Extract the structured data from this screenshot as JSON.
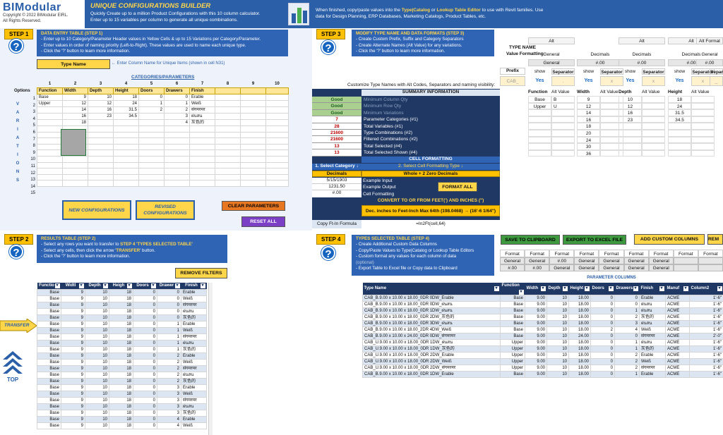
{
  "header": {
    "logo": "BIModular",
    "copyright": "Copyright © 2022 BIModular EIRL.",
    "rights": "All Rights Reserved.",
    "title": "UNIQUE CONFIGURATIONS BUILDER",
    "desc1": "Quickly Create up to a million Product Configurations with this 10 column calculator.",
    "desc2": "Enter up to 15 variables per column to generate all unique combinations.",
    "note_a": "When finished, copy/paste values into the ",
    "note_b": "Type|Catalog",
    "note_c": " or ",
    "note_d": "Lookup Table Editor",
    "note_e": " to use with Revit families.  Use data for Design Planning, ERP Databases, Marketing Catalogs, Product Tables, etc."
  },
  "step1": {
    "label": "STEP 1",
    "title": "DATA ENTRY TABLE  (STEP 1)",
    "lines": [
      "- Enter up to 10 Category/Parameter Header values in Yellow Cells & up to 15 Variations per Category/Parameter.",
      "- Enter values in order of naming priority (Left-to-Right).  These values are used to name each unique type.",
      "- Click the '?' button to learn more information."
    ],
    "type_name": "Type Name",
    "type_name_hint": "Enter Column Name for Unique Items (shown in cell N31)",
    "cat_title": "CATEGORIES/PARAMETERS",
    "col_nums": [
      "1",
      "2",
      "3",
      "4",
      "5",
      "6",
      "7",
      "8",
      "9",
      "10"
    ],
    "options_label": "Options",
    "headers": [
      "Function",
      "Width",
      "Depth",
      "Height",
      "Doors",
      "Drawers",
      "Finish",
      "",
      "",
      ""
    ],
    "rows": [
      [
        "Base",
        "9",
        "10",
        "18",
        "0",
        "0",
        "Érable",
        "",
        "",
        ""
      ],
      [
        "Upper",
        "12",
        "12",
        "24",
        "1",
        "1",
        "Weiß",
        "",
        "",
        ""
      ],
      [
        "",
        "14",
        "16",
        "31.5",
        "2",
        "2",
        "संगमरमर",
        "",
        "",
        ""
      ],
      [
        "",
        "16",
        "23",
        "34.5",
        "",
        "3",
        "ฝนสน",
        "",
        "",
        ""
      ],
      [
        "",
        "18",
        "",
        "",
        "",
        "4",
        "灰色的",
        "",
        "",
        ""
      ],
      [
        "",
        "",
        "",
        "",
        "",
        "",
        "",
        "",
        "",
        ""
      ],
      [
        "",
        "",
        "",
        "",
        "",
        "",
        "",
        "",
        "",
        ""
      ],
      [
        "",
        "",
        "",
        "",
        "",
        "",
        "",
        "",
        "",
        ""
      ],
      [
        "",
        "",
        "",
        "",
        "",
        "",
        "",
        "",
        "",
        ""
      ],
      [
        "",
        "",
        "",
        "",
        "",
        "",
        "",
        "",
        "",
        ""
      ],
      [
        "",
        "",
        "",
        "",
        "",
        "",
        "",
        "",
        "",
        ""
      ],
      [
        "",
        "",
        "",
        "",
        "",
        "",
        "",
        "",
        "",
        ""
      ],
      [
        "",
        "",
        "",
        "",
        "",
        "",
        "",
        "",
        "",
        ""
      ],
      [
        "",
        "",
        "",
        "",
        "",
        "",
        "",
        "",
        "",
        ""
      ],
      [
        "",
        "",
        "",
        "",
        "",
        "",
        "",
        "",
        "",
        ""
      ]
    ],
    "row_nums": [
      "1",
      "2",
      "3",
      "4",
      "5",
      "6",
      "7",
      "8",
      "9",
      "10",
      "11",
      "12",
      "13",
      "14",
      "15"
    ],
    "variations": [
      "V",
      "A",
      "R",
      "I",
      "A",
      "T",
      "I",
      "O",
      "N",
      "S"
    ],
    "new_config": "NEW CONFIGURATIONS",
    "revised_config": "REVISED CONFIGURATIONS",
    "clear": "CLEAR PARAMETERS",
    "reset": "RESET ALL"
  },
  "step2": {
    "label": "STEP 2",
    "title": "RESULTS TABLE (STEP 2)",
    "line1a": "- Select any rows you want to transfer to ",
    "line1b": "STEP 4 'TYPES SELECTED TABLE'",
    "line2a": "- Select any cells, then click the arrow '",
    "line2b": "TRANSFER",
    "line2c": "' button.",
    "line3": "- Click the '?' button to learn more information.",
    "remove_filters": "REMOVE FILTERS",
    "transfer": "TRANSFER",
    "top": "TOP",
    "headers": [
      "Functio",
      "Widtl",
      "Depth",
      "Heigh",
      "Doors",
      "Drawer",
      "Finish"
    ],
    "rows": [
      [
        "Base",
        "9",
        "10",
        "18",
        "0",
        "0",
        "Érable"
      ],
      [
        "Base",
        "9",
        "10",
        "18",
        "0",
        "0",
        "Weiß"
      ],
      [
        "Base",
        "9",
        "10",
        "18",
        "0",
        "0",
        "संगमरमर"
      ],
      [
        "Base",
        "9",
        "10",
        "18",
        "0",
        "0",
        "ฝนสน"
      ],
      [
        "Base",
        "9",
        "10",
        "18",
        "0",
        "0",
        "灰色的"
      ],
      [
        "Base",
        "9",
        "10",
        "18",
        "0",
        "1",
        "Érable"
      ],
      [
        "Base",
        "9",
        "10",
        "18",
        "0",
        "1",
        "Weiß"
      ],
      [
        "Base",
        "9",
        "10",
        "18",
        "0",
        "1",
        "संगमरमर"
      ],
      [
        "Base",
        "9",
        "10",
        "18",
        "0",
        "1",
        "ฝนสน"
      ],
      [
        "Base",
        "9",
        "10",
        "18",
        "0",
        "1",
        "灰色的"
      ],
      [
        "Base",
        "9",
        "10",
        "18",
        "0",
        "2",
        "Érable"
      ],
      [
        "Base",
        "9",
        "10",
        "18",
        "0",
        "2",
        "Weiß"
      ],
      [
        "Base",
        "9",
        "10",
        "18",
        "0",
        "2",
        "संगमरमर"
      ],
      [
        "Base",
        "9",
        "10",
        "18",
        "0",
        "2",
        "ฝนสน"
      ],
      [
        "Base",
        "9",
        "10",
        "18",
        "0",
        "2",
        "灰色的"
      ],
      [
        "Base",
        "9",
        "10",
        "18",
        "0",
        "3",
        "Érable"
      ],
      [
        "Base",
        "9",
        "10",
        "18",
        "0",
        "3",
        "Weiß"
      ],
      [
        "Base",
        "9",
        "10",
        "18",
        "0",
        "3",
        "संगमरमर"
      ],
      [
        "Base",
        "9",
        "10",
        "18",
        "0",
        "3",
        "ฝนสน"
      ],
      [
        "Base",
        "9",
        "10",
        "18",
        "0",
        "3",
        "灰色的"
      ],
      [
        "Base",
        "9",
        "10",
        "18",
        "0",
        "4",
        "Érable"
      ],
      [
        "Base",
        "9",
        "10",
        "18",
        "0",
        "4",
        "Weiß"
      ]
    ]
  },
  "step3": {
    "label": "STEP 3",
    "title": "MODIFY TYPE NAME AND DATA FORMATS (STEP 3)",
    "lines": [
      "- Create Custom Prefix, Suffix and Category Separators",
      "- Create Alternate Names (Alt Value) for any variations.",
      "- Click the '?' button to learn more information."
    ],
    "customize": "Customize Type Names with Alt Codes, Separators and naming visibility:",
    "summary_title": "SUMMARY INFORMATION",
    "summary": [
      [
        "Good",
        "Minimum Column Qty"
      ],
      [
        "Good",
        "Minimum Row Qty"
      ],
      [
        "Good",
        "Minimum Variations"
      ],
      [
        "7",
        "Parameter Categories (#1)"
      ],
      [
        "28",
        "Total Variables (#1)"
      ],
      [
        "21600",
        "Type Combinations (#2)"
      ],
      [
        "21600",
        "Filtered Combinations (#2)"
      ],
      [
        "13",
        "Total Selected (#4)"
      ],
      [
        "13",
        "Total Selected Shown (#4)"
      ]
    ],
    "cell_formatting": "CELL FORMATTING",
    "select_category": "1. Select Category",
    "select_type": "2. Select Cell Formatting Type",
    "decimals": "Decimals",
    "whole_zero": "Whole + 2 Zero Decimals",
    "ex_in_val": "5/15/1903",
    "ex_in_lbl": "Example Input",
    "ex_out_val": "1231.50",
    "ex_out_lbl": "Example Output",
    "cf_val": "#.00",
    "cf_lbl": "Cell Formatting",
    "format_all": "FORMAT ALL",
    "convert": "CONVERT TO OR FROM FEET(') AND INCHES (\")",
    "dec_inch": "Dec. inches to Feet-Inch Max 64th  (198.0468) → (16'-6  1/64\")",
    "copy_formula": "Copy Ft-In Formula",
    "formula": "=In2Ft(cell,64)",
    "type_name_label": "TYPE NAME",
    "value_formatting": "Value Formatting",
    "prefix": "Prefix",
    "prefix_val": "CAB_",
    "fmt_cols": [
      {
        "alt": "Alt",
        "fmt": "General",
        "fmt2": "General",
        "show": "show",
        "sep": "Separator",
        "yes": "Yes",
        "sepv": ".",
        "h1": "Function",
        "h2": "Alt Value",
        "vals": [
          [
            "Base",
            "B"
          ],
          [
            "Upper",
            "U"
          ],
          [
            "",
            ""
          ],
          [
            "",
            ""
          ],
          [
            "",
            ""
          ],
          [
            "",
            ""
          ],
          [
            "",
            ""
          ],
          [
            "",
            ""
          ]
        ]
      },
      {
        "alt": "",
        "fmt": "Decimals",
        "fmt2": "#.00",
        "show": "show",
        "sep": "Separator",
        "yes": "Yes",
        "sepv": "x",
        "h1": "Width",
        "h2": "Alt Value",
        "vals": [
          [
            "9",
            ""
          ],
          [
            "12",
            ""
          ],
          [
            "14",
            ""
          ],
          [
            "16",
            ""
          ],
          [
            "18",
            ""
          ],
          [
            "20",
            ""
          ],
          [
            "24",
            ""
          ],
          [
            "30",
            ""
          ],
          [
            "36",
            ""
          ]
        ]
      },
      {
        "alt": "Alt",
        "fmt": "Decimals",
        "fmt2": "#.00",
        "show": "show",
        "sep": "Separator",
        "yes": "Yes",
        "sepv": "x",
        "h1": "Depth",
        "h2": "Alt Value",
        "vals": [
          [
            "10",
            ""
          ],
          [
            "12",
            ""
          ],
          [
            "16",
            ""
          ],
          [
            "23",
            ""
          ]
        ]
      },
      {
        "alt": "Alt",
        "fmt": "Decimals",
        "fmt2": "#.00",
        "show": "show",
        "sep": "Separator",
        "yes": "Yes",
        "sepv": "x",
        "h1": "Height",
        "h2": "Alt Value",
        "vals": [
          [
            "18",
            ""
          ],
          [
            "24",
            ""
          ],
          [
            "31.5",
            ""
          ],
          [
            "34.5",
            ""
          ]
        ]
      },
      {
        "alt": "Alt Format",
        "fmt": "General",
        "fmt2": "#.00",
        "show": "",
        "sep": "Separator",
        "yes": "",
        "sepv": "_",
        "h1": "",
        "h2": "",
        "vals": []
      }
    ]
  },
  "step4": {
    "label": "STEP 4",
    "title": "TYPES SELECTED TABLE (STEP 4)",
    "lines": [
      "- Create Additional Custom Data Columns",
      "- Copy/Paste Values to Type|Catalog or Lookup Table Editors",
      "- Custom format any values for each column of data",
      "(optional)",
      "- Export Table to Excel file or Copy data to Clipboard"
    ],
    "save_clip": "SAVE TO CLIPBOARD",
    "export": "EXPORT TO EXCEL FILE",
    "add_custom": "ADD CUSTOM COLUMNS",
    "rem": "REM",
    "format_label": "Format",
    "formats": [
      "General",
      "#.00",
      "General",
      "#.00",
      "#.00",
      "General",
      "General",
      "General",
      "General",
      "General",
      "General",
      "General",
      "General",
      "General"
    ],
    "param_cols": "PARAMETER COLUMNS",
    "headers": [
      "Type Name",
      "Function",
      "Width",
      "Depth",
      "Height",
      "Doors",
      "Drawers",
      "Finish",
      "Manuf",
      "Column2"
    ],
    "rows": [
      [
        "CAB_B.9.00 x 10.00 x 18.00_0DR 0DW_Érable",
        "Base",
        "9.00",
        "10",
        "18.00",
        "0",
        "0",
        "Érable",
        "ACME",
        "1'-6\""
      ],
      [
        "CAB_B.9.00 x 10.00 x 18.00_0DR 0DW_ฝนสน",
        "Base",
        "9.00",
        "10",
        "18.00",
        "0",
        "0",
        "ฝนสน",
        "ACME",
        "1'-6\""
      ],
      [
        "CAB_B.9.00 x 10.00 x 18.00_0DR 1DW_ฝนสน",
        "Base",
        "9.00",
        "10",
        "18.00",
        "0",
        "1",
        "ฝนสน",
        "ACME",
        "1'-6\""
      ],
      [
        "CAB_B.9.00 x 10.00 x 18.00_0DR 2DW_灰色的",
        "Base",
        "9.00",
        "10",
        "18.00",
        "0",
        "2",
        "灰色的",
        "ACME",
        "1'-6\""
      ],
      [
        "CAB_B.9.00 x 10.00 x 18.00_0DR 3DW_ฝนสน",
        "Base",
        "9.00",
        "10",
        "18.00",
        "0",
        "3",
        "ฝนสน",
        "ACME",
        "1'-6\""
      ],
      [
        "CAB_B.9.00 x 10.00 x 18.00_2DR 4DW_Weiß",
        "Base",
        "9.00",
        "10",
        "18.00",
        "2",
        "4",
        "Weiß",
        "ACME",
        "1'-6\""
      ],
      [
        "CAB_B.9.00 x 10.00 x 24.00_0DR 0DW_संगमरमर",
        "Base",
        "9.00",
        "10",
        "24.00",
        "0",
        "0",
        "संगमरमर",
        "ACME",
        "2'-0\""
      ],
      [
        "CAB_U.9.00 x 10.00 x 18.00_0DR 1DW_ฝนสน",
        "Upper",
        "9.00",
        "10",
        "18.00",
        "0",
        "1",
        "ฝนสน",
        "ACME",
        "1'-6\""
      ],
      [
        "CAB_U.9.00 x 10.00 x 18.00_0DR 1DW_灰色的",
        "Upper",
        "9.00",
        "10",
        "18.00",
        "0",
        "1",
        "灰色的",
        "ACME",
        "1'-6\""
      ],
      [
        "CAB_U.9.00 x 10.00 x 18.00_0DR 2DW_Érable",
        "Upper",
        "9.00",
        "10",
        "18.00",
        "0",
        "2",
        "Érable",
        "ACME",
        "1'-6\""
      ],
      [
        "CAB_U.9.00 x 10.00 x 18.00_0DR 2DW_Weiß",
        "Upper",
        "9.00",
        "10",
        "18.00",
        "0",
        "2",
        "Weiß",
        "ACME",
        "1'-6\""
      ],
      [
        "CAB_U.9.00 x 10.00 x 18.00_0DR 2DW_संगमरमर",
        "Upper",
        "9.00",
        "10",
        "18.00",
        "0",
        "2",
        "संगमरमर",
        "ACME",
        "1'-6\""
      ],
      [
        "CAB_B.9.00 x 10.00 x 18.00_0DR 1DW_Érable",
        "Base",
        "9.00",
        "10",
        "18.00",
        "0",
        "1",
        "Érable",
        "ACME",
        "1'-6\""
      ]
    ]
  }
}
